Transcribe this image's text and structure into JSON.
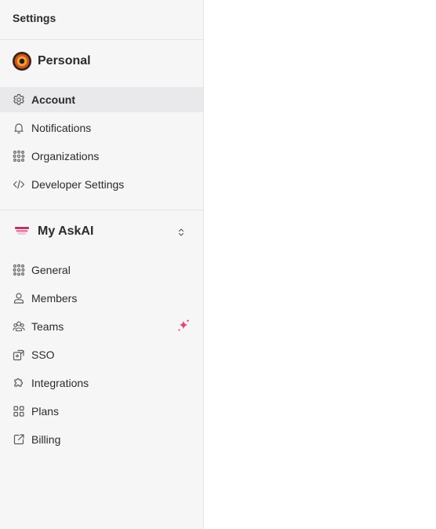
{
  "sidebar": {
    "title": "Settings",
    "personal": {
      "name": "Personal",
      "items": [
        {
          "label": "Account",
          "icon": "gear-icon",
          "active": true
        },
        {
          "label": "Notifications",
          "icon": "bell-icon"
        },
        {
          "label": "Organizations",
          "icon": "organizations-icon"
        },
        {
          "label": "Developer Settings",
          "icon": "code-icon"
        }
      ]
    },
    "org": {
      "name": "My AskAI",
      "items": [
        {
          "label": "General",
          "icon": "general-icon"
        },
        {
          "label": "Members",
          "icon": "user-icon"
        },
        {
          "label": "Teams",
          "icon": "users-icon",
          "badge_icon": "sparkle-icon"
        },
        {
          "label": "SSO",
          "icon": "sso-icon"
        },
        {
          "label": "Integrations",
          "icon": "puzzle-icon"
        },
        {
          "label": "Plans",
          "icon": "grid-icon"
        },
        {
          "label": "Billing",
          "icon": "external-link-icon"
        }
      ]
    }
  },
  "colors": {
    "sidebar_bg": "#f6f6f6",
    "active_bg": "#e9e9eb",
    "accent_pink": "#e0457b"
  }
}
